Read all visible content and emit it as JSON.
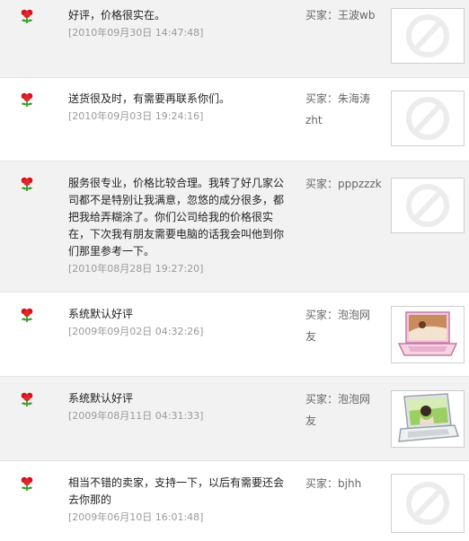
{
  "buyer_prefix": "买家：",
  "reviews": [
    {
      "comment": "好评，价格很实在。",
      "date": "[2010年09月30日 14:47:48]",
      "buyer": "王波wb",
      "thumbnail": "no-image-icon"
    },
    {
      "comment": "送货很及时，有需要再联系你们。",
      "date": "[2010年09月03日 19:24:16]",
      "buyer": "朱海涛zht",
      "thumbnail": "no-image-icon"
    },
    {
      "comment": "服务很专业，价格比较合理。我转了好几家公司都不是特别让我满意，忽悠的成分很多，都把我给弄糊涂了。你们公司给我的价格很实在，下次我有朋友需要电脑的话我会叫他到你们那里参考一下。",
      "date": "[2010年08月28日 19:27:20]",
      "buyer": "pppzzzk",
      "thumbnail": "no-image-icon"
    },
    {
      "comment": "系统默认好评",
      "date": "[2009年09月02日 04:32:26]",
      "buyer": "泡泡网友",
      "thumbnail": "laptop-pink-photo"
    },
    {
      "comment": "系统默认好评",
      "date": "[2009年08月11日 04:31:33]",
      "buyer": "泡泡网友",
      "thumbnail": "laptop-silver-photo"
    },
    {
      "comment": "相当不错的卖家，支持一下，以后有需要还会去你那的",
      "date": "[2009年06月10日 16:01:48]",
      "buyer": "bjhh",
      "thumbnail": "no-image-icon"
    }
  ]
}
